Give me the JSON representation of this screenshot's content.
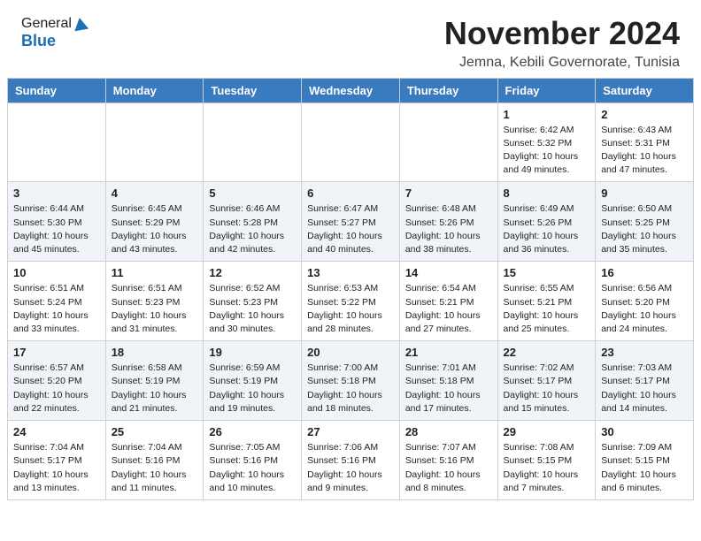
{
  "header": {
    "logo_general": "General",
    "logo_blue": "Blue",
    "month": "November 2024",
    "location": "Jemna, Kebili Governorate, Tunisia"
  },
  "weekdays": [
    "Sunday",
    "Monday",
    "Tuesday",
    "Wednesday",
    "Thursday",
    "Friday",
    "Saturday"
  ],
  "weeks": [
    [
      {
        "day": "",
        "info": ""
      },
      {
        "day": "",
        "info": ""
      },
      {
        "day": "",
        "info": ""
      },
      {
        "day": "",
        "info": ""
      },
      {
        "day": "",
        "info": ""
      },
      {
        "day": "1",
        "info": "Sunrise: 6:42 AM\nSunset: 5:32 PM\nDaylight: 10 hours\nand 49 minutes."
      },
      {
        "day": "2",
        "info": "Sunrise: 6:43 AM\nSunset: 5:31 PM\nDaylight: 10 hours\nand 47 minutes."
      }
    ],
    [
      {
        "day": "3",
        "info": "Sunrise: 6:44 AM\nSunset: 5:30 PM\nDaylight: 10 hours\nand 45 minutes."
      },
      {
        "day": "4",
        "info": "Sunrise: 6:45 AM\nSunset: 5:29 PM\nDaylight: 10 hours\nand 43 minutes."
      },
      {
        "day": "5",
        "info": "Sunrise: 6:46 AM\nSunset: 5:28 PM\nDaylight: 10 hours\nand 42 minutes."
      },
      {
        "day": "6",
        "info": "Sunrise: 6:47 AM\nSunset: 5:27 PM\nDaylight: 10 hours\nand 40 minutes."
      },
      {
        "day": "7",
        "info": "Sunrise: 6:48 AM\nSunset: 5:26 PM\nDaylight: 10 hours\nand 38 minutes."
      },
      {
        "day": "8",
        "info": "Sunrise: 6:49 AM\nSunset: 5:26 PM\nDaylight: 10 hours\nand 36 minutes."
      },
      {
        "day": "9",
        "info": "Sunrise: 6:50 AM\nSunset: 5:25 PM\nDaylight: 10 hours\nand 35 minutes."
      }
    ],
    [
      {
        "day": "10",
        "info": "Sunrise: 6:51 AM\nSunset: 5:24 PM\nDaylight: 10 hours\nand 33 minutes."
      },
      {
        "day": "11",
        "info": "Sunrise: 6:51 AM\nSunset: 5:23 PM\nDaylight: 10 hours\nand 31 minutes."
      },
      {
        "day": "12",
        "info": "Sunrise: 6:52 AM\nSunset: 5:23 PM\nDaylight: 10 hours\nand 30 minutes."
      },
      {
        "day": "13",
        "info": "Sunrise: 6:53 AM\nSunset: 5:22 PM\nDaylight: 10 hours\nand 28 minutes."
      },
      {
        "day": "14",
        "info": "Sunrise: 6:54 AM\nSunset: 5:21 PM\nDaylight: 10 hours\nand 27 minutes."
      },
      {
        "day": "15",
        "info": "Sunrise: 6:55 AM\nSunset: 5:21 PM\nDaylight: 10 hours\nand 25 minutes."
      },
      {
        "day": "16",
        "info": "Sunrise: 6:56 AM\nSunset: 5:20 PM\nDaylight: 10 hours\nand 24 minutes."
      }
    ],
    [
      {
        "day": "17",
        "info": "Sunrise: 6:57 AM\nSunset: 5:20 PM\nDaylight: 10 hours\nand 22 minutes."
      },
      {
        "day": "18",
        "info": "Sunrise: 6:58 AM\nSunset: 5:19 PM\nDaylight: 10 hours\nand 21 minutes."
      },
      {
        "day": "19",
        "info": "Sunrise: 6:59 AM\nSunset: 5:19 PM\nDaylight: 10 hours\nand 19 minutes."
      },
      {
        "day": "20",
        "info": "Sunrise: 7:00 AM\nSunset: 5:18 PM\nDaylight: 10 hours\nand 18 minutes."
      },
      {
        "day": "21",
        "info": "Sunrise: 7:01 AM\nSunset: 5:18 PM\nDaylight: 10 hours\nand 17 minutes."
      },
      {
        "day": "22",
        "info": "Sunrise: 7:02 AM\nSunset: 5:17 PM\nDaylight: 10 hours\nand 15 minutes."
      },
      {
        "day": "23",
        "info": "Sunrise: 7:03 AM\nSunset: 5:17 PM\nDaylight: 10 hours\nand 14 minutes."
      }
    ],
    [
      {
        "day": "24",
        "info": "Sunrise: 7:04 AM\nSunset: 5:17 PM\nDaylight: 10 hours\nand 13 minutes."
      },
      {
        "day": "25",
        "info": "Sunrise: 7:04 AM\nSunset: 5:16 PM\nDaylight: 10 hours\nand 11 minutes."
      },
      {
        "day": "26",
        "info": "Sunrise: 7:05 AM\nSunset: 5:16 PM\nDaylight: 10 hours\nand 10 minutes."
      },
      {
        "day": "27",
        "info": "Sunrise: 7:06 AM\nSunset: 5:16 PM\nDaylight: 10 hours\nand 9 minutes."
      },
      {
        "day": "28",
        "info": "Sunrise: 7:07 AM\nSunset: 5:16 PM\nDaylight: 10 hours\nand 8 minutes."
      },
      {
        "day": "29",
        "info": "Sunrise: 7:08 AM\nSunset: 5:15 PM\nDaylight: 10 hours\nand 7 minutes."
      },
      {
        "day": "30",
        "info": "Sunrise: 7:09 AM\nSunset: 5:15 PM\nDaylight: 10 hours\nand 6 minutes."
      }
    ]
  ]
}
